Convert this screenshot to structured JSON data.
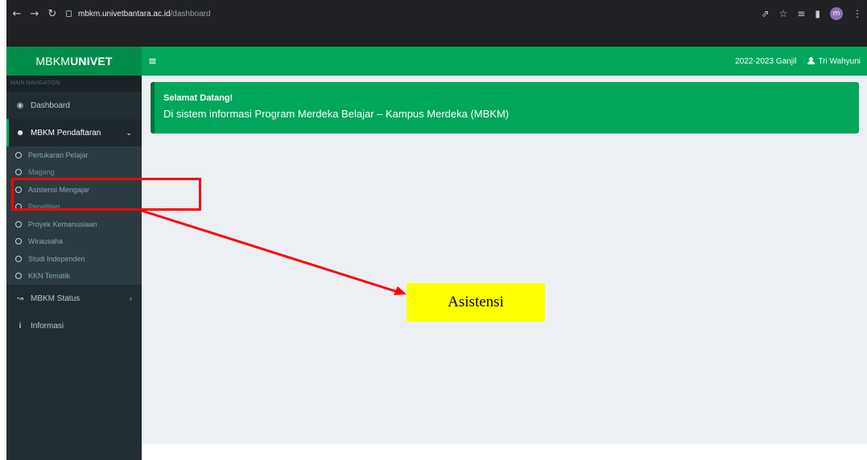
{
  "browser": {
    "url_host": "mbkm.univetbantara.ac.id",
    "url_path": "/dashboard",
    "profile_initial": "m"
  },
  "header": {
    "logo_prefix": "MBKM",
    "logo_bold": "UNIVET",
    "menu_icon": "hamburger-icon",
    "semester": "2022-2023 Ganjil",
    "user_name": "Tri Wahyuni"
  },
  "sidebar": {
    "section_label": "MAIN NAVIGATION",
    "dashboard": "Dashboard",
    "pendaftaran": "MBKM Pendaftaran",
    "sub_items": [
      "Pertukaran Pelajar",
      "Magang",
      "Asistensi Mengajar",
      "Penelitian",
      "Proyek Kemanusiaan",
      "Wirausaha",
      "Studi Independen",
      "KKN Tematik"
    ],
    "status": "MBKM Status",
    "informasi": "Informasi"
  },
  "content": {
    "callout_title": "Selamat Datang!",
    "callout_message": "Di sistem informasi Program Merdeka Belajar – Kampus Merdeka (MBKM)"
  },
  "annotation": {
    "label": "Asistensi",
    "colors": {
      "box": "#ff0000",
      "label_bg": "#ffff00"
    }
  },
  "colors": {
    "brand_green": "#00a65a",
    "sidebar_bg": "#222d32",
    "content_bg": "#ecf0f5"
  }
}
